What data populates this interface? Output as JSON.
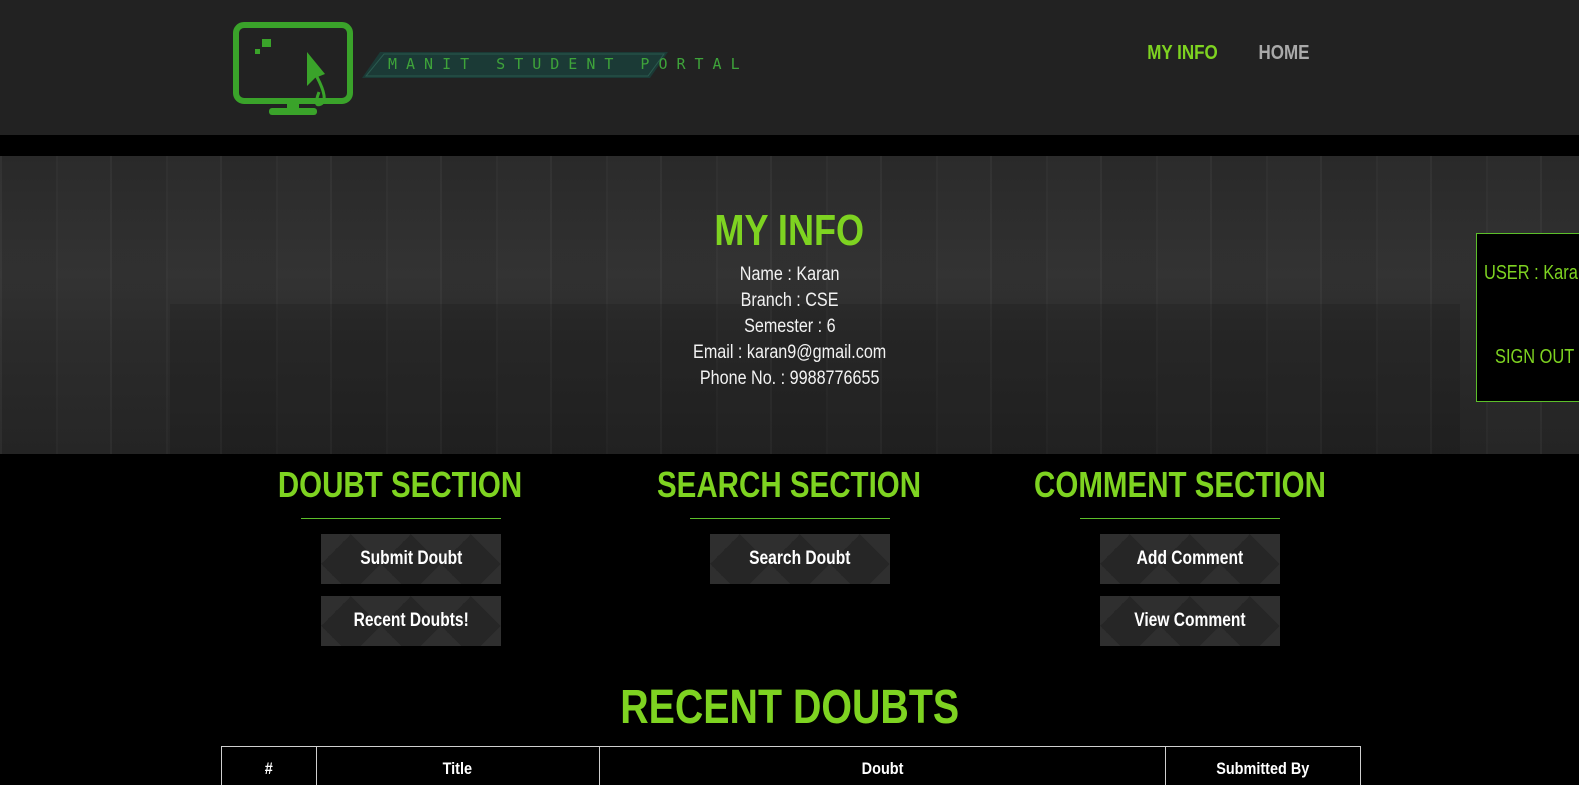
{
  "header": {
    "logo_text": "MANIT STUDENT PORTAL",
    "nav": [
      {
        "label": "MY INFO",
        "active": true
      },
      {
        "label": "HOME",
        "active": false
      }
    ]
  },
  "hero": {
    "title": "MY INFO",
    "name_line": "Name : Karan",
    "branch_line": "Branch : CSE",
    "semester_line": "Semester : 6",
    "email_line": "Email : karan9@gmail.com",
    "phone_line": "Phone No. : 9988776655"
  },
  "user_panel": {
    "user_label": "USER : Karan",
    "signout_label": "SIGN OUT"
  },
  "sections": {
    "doubt": {
      "title": "DOUBT SECTION",
      "buttons": [
        "Submit Doubt",
        "Recent Doubts!"
      ]
    },
    "search": {
      "title": "SEARCH SECTION",
      "buttons": [
        "Search Doubt"
      ]
    },
    "comment": {
      "title": "COMMENT SECTION",
      "buttons": [
        "Add Comment",
        "View Comment"
      ]
    }
  },
  "recent": {
    "title": "RECENT DOUBTS",
    "columns": [
      "#",
      "Title",
      "Doubt",
      "Submitted By"
    ]
  },
  "colors": {
    "accent": "#7ed321",
    "header_bg": "#222222",
    "page_bg": "#000000"
  },
  "icons": [
    "monitor-cursor-logo-icon"
  ]
}
